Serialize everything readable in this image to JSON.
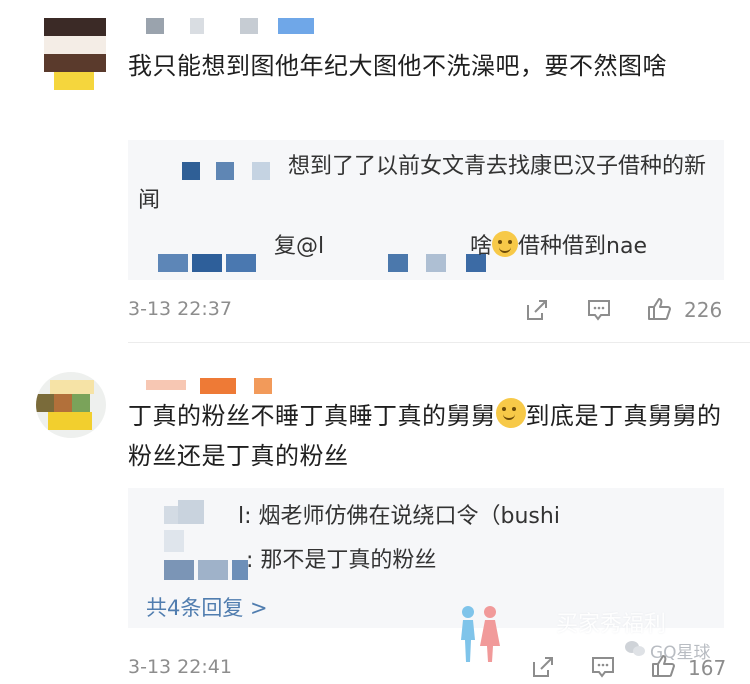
{
  "comments": [
    {
      "text": "我只能想到图他年纪大图他不洗澡吧，要不然图啥",
      "reply_1_text": "想到了了以前女文青去找康巴汉子借种的新闻",
      "reply_2_prefix": "复@l",
      "reply_2_suffix": "啥",
      "reply_2_tail": "借种借到nae",
      "time": "3-13 22:37",
      "likes": "226"
    },
    {
      "text_part1": "丁真的粉丝不睡丁真睡丁真的舅舅",
      "text_part2": "到底是丁真舅舅的粉丝还是丁真的粉丝",
      "reply_1_text": "l: 烟老师仿佛在说绕口令（bushi",
      "reply_2_text": ": 那不是丁真的粉丝",
      "more_replies": "共4条回复 >",
      "time": "3-13 22:41",
      "likes": "167"
    }
  ],
  "watermark": {
    "text": "买家秀福利",
    "account": "GQ星球"
  },
  "icons": {
    "share": "share-icon",
    "comment": "comment-icon",
    "like": "thumbs-up-icon"
  },
  "colors": {
    "link": "#507daf",
    "meta": "#8d8d8d",
    "reply_bg": "#f6f7f9"
  }
}
